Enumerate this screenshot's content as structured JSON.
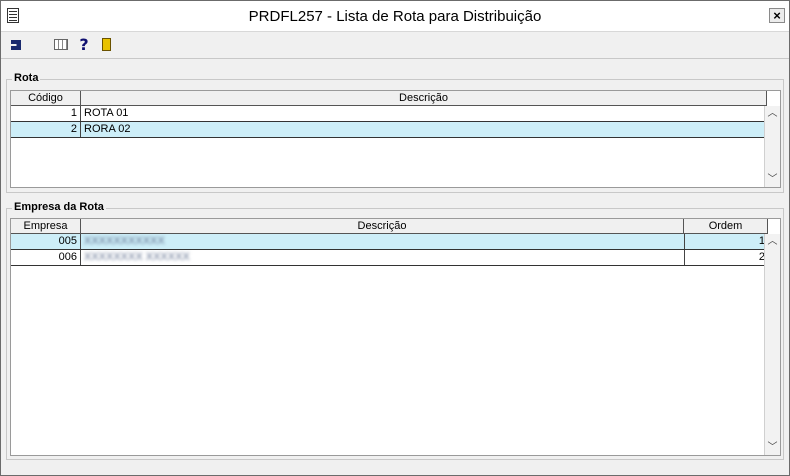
{
  "window": {
    "title": "PRDFL257 - Lista de Rota para Distribuição",
    "close_glyph": "×"
  },
  "toolbar": {
    "icons": [
      "exit-icon",
      "calculator-icon",
      "help-icon",
      "door-exit-icon"
    ],
    "help_glyph": "?"
  },
  "rota": {
    "label": "Rota",
    "columns": [
      "Código",
      "Descrição"
    ],
    "rows": [
      {
        "codigo": "1",
        "descricao": "ROTA 01",
        "selected": false
      },
      {
        "codigo": "2",
        "descricao": "RORA 02",
        "selected": true
      }
    ],
    "scroll_up": "︿",
    "scroll_down": "﹀"
  },
  "empresa": {
    "label": "Empresa da Rota",
    "columns": [
      "Empresa",
      "Descrição",
      "Ordem"
    ],
    "rows": [
      {
        "empresa": "005",
        "descricao": "XXXXXXXXXXX",
        "ordem": "1",
        "selected": true
      },
      {
        "empresa": "006",
        "descricao": "XXXXXXXX XXXXXX",
        "ordem": "2",
        "selected": false
      }
    ],
    "scroll_up": "︿",
    "scroll_down": "﹀"
  }
}
